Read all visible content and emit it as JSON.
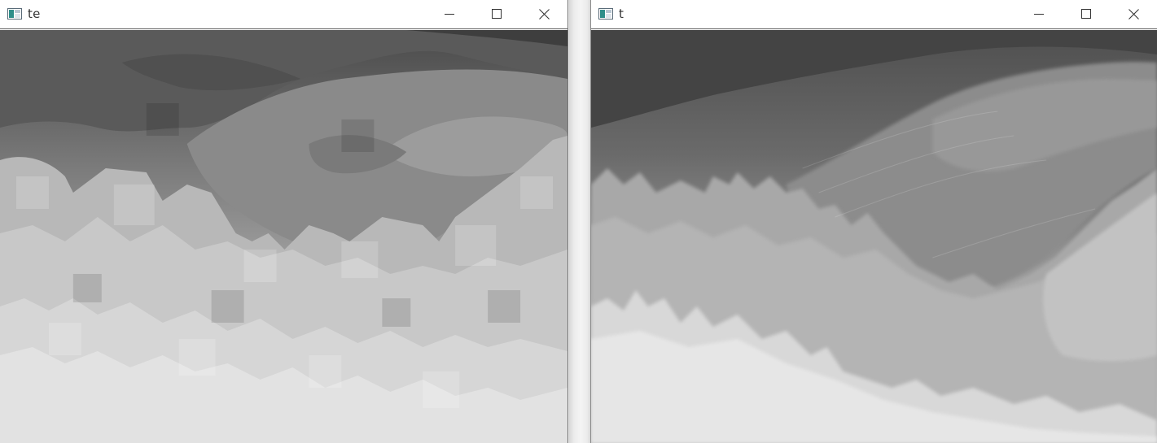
{
  "windows": [
    {
      "title": "te",
      "icon": "opencv-window-icon",
      "controls": [
        "minimize",
        "maximize",
        "close"
      ],
      "content": "blocky-grayscale-depth-image"
    },
    {
      "title": "t",
      "icon": "opencv-window-icon",
      "controls": [
        "minimize",
        "maximize",
        "close"
      ],
      "content": "smooth-grayscale-depth-image"
    }
  ],
  "colors": {
    "titlebar_bg": "#ffffff",
    "title_text": "#333333",
    "icon_teal": "#2f8f8a",
    "desktop_bg": "#efefef"
  }
}
